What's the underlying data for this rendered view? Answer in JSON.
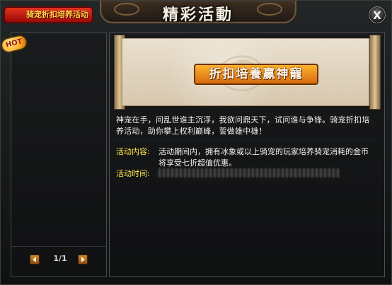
{
  "window": {
    "title": "精彩活動",
    "close_label": "X"
  },
  "sidebar": {
    "items": [
      {
        "label": "骑宠折扣培养活动",
        "badge": "HOT"
      }
    ],
    "pagination": "1/1"
  },
  "main": {
    "banner_title": "折扣培養贏神寵",
    "intro_text": "神宠在手，问乱世谁主沉浮，我欲问鼎天下，试问谁与争锋。骑宠折扣培养活动，助你攀上权利巅峰，誓做雄中雄！",
    "content_label": "活动内容:",
    "content_text": "活动期间内，拥有冰象或以上骑宠的玩家培养骑宠消耗的金币将享受七折超值优惠。",
    "time_label": "活动时间:",
    "time_text": ""
  }
}
